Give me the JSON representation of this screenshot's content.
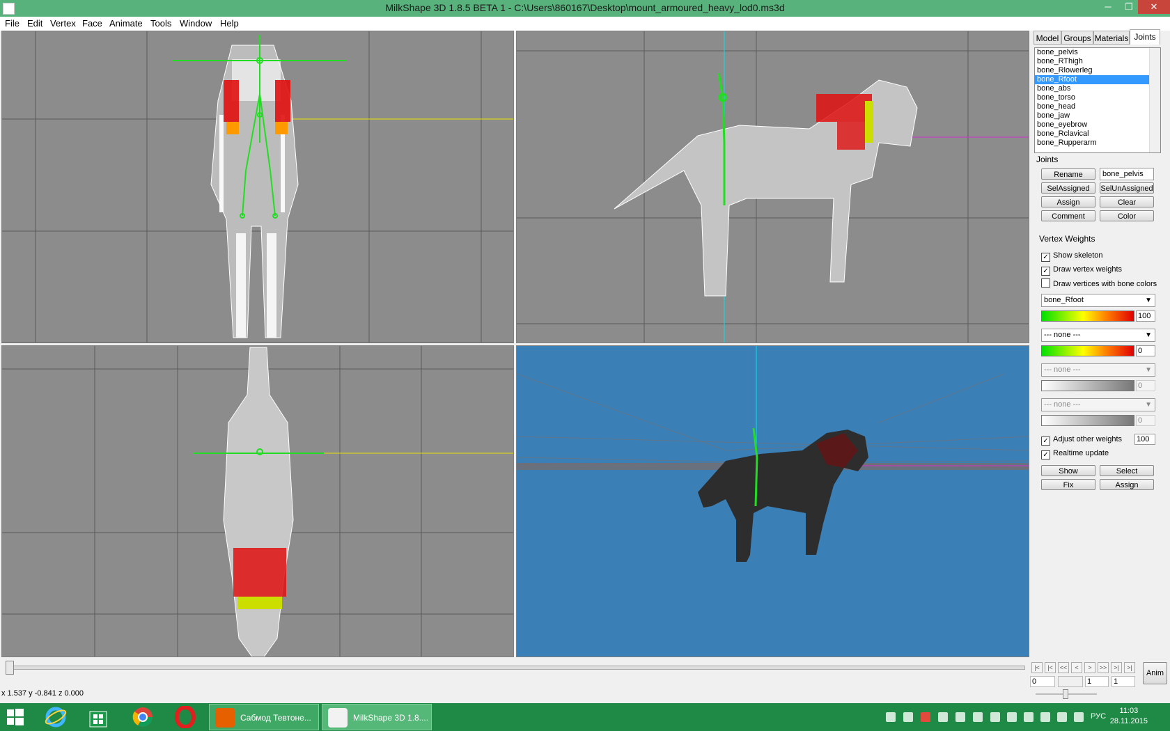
{
  "window": {
    "title": "MilkShape 3D 1.8.5 BETA 1 - C:\\Users\\860167\\Desktop\\mount_armoured_heavy_lod0.ms3d",
    "minimize": "─",
    "maximize": "❐",
    "close": "✕"
  },
  "menu": [
    "File",
    "Edit",
    "Vertex",
    "Face",
    "Animate",
    "Tools",
    "Window",
    "Help"
  ],
  "tabs": [
    "Model",
    "Groups",
    "Materials",
    "Joints"
  ],
  "joints": {
    "list": [
      "bone_pelvis",
      "bone_RThigh",
      "bone_Rlowerleg",
      "bone_Rfoot",
      "bone_abs",
      "bone_torso",
      "bone_head",
      "bone_jaw",
      "bone_eyebrow",
      "bone_Rclavical",
      "bone_Rupperarm"
    ],
    "selected_index": 3,
    "group_label": "Joints",
    "name_field": "bone_pelvis",
    "buttons": {
      "rename": "Rename",
      "sel_assigned": "SelAssigned",
      "sel_unassigned": "SelUnAssigned",
      "assign": "Assign",
      "clear": "Clear",
      "comment": "Comment",
      "color": "Color"
    }
  },
  "vertex_weights": {
    "group_label": "Vertex Weights",
    "show_skeleton": {
      "label": "Show skeleton",
      "checked": true
    },
    "draw_vertex_weights": {
      "label": "Draw vertex weights",
      "checked": true
    },
    "draw_bone_colors": {
      "label": "Draw vertices with bone colors",
      "checked": false
    },
    "bone1": {
      "value": "bone_Rfoot",
      "weight": "100"
    },
    "bone2": {
      "value": "--- none ---",
      "weight": "0"
    },
    "bone3": {
      "value": "--- none ---",
      "weight": "0"
    },
    "bone4": {
      "value": "--- none ---",
      "weight": "0"
    },
    "adjust_other": {
      "label": "Adjust other weights",
      "checked": true,
      "value": "100"
    },
    "realtime": {
      "label": "Realtime update",
      "checked": true
    },
    "buttons": {
      "show": "Show",
      "select": "Select",
      "fix": "Fix",
      "assign": "Assign"
    }
  },
  "timeline": {
    "frame_start": "0",
    "frame_current": "1",
    "frame_end": "1",
    "anim_label": "Anim",
    "nav": [
      "|<",
      "|<",
      "<<",
      "<",
      ">",
      ">>",
      ">|",
      ">|"
    ]
  },
  "status": "x 1.537 y -0.841 z 0.000",
  "taskbar": {
    "tasks": [
      "Сабмод Тевтоне...",
      "MilkShape 3D 1.8...."
    ],
    "lang": "РУС",
    "time": "11:03",
    "date": "28.11.2015"
  },
  "colors": {
    "titlebar": "#57b27b",
    "taskbar": "#1f8a46",
    "viewport_bg": "#8c8c8c",
    "viewport_3d_bg": "#3a7fb5",
    "bone": "#22dd22",
    "selection": "#3399ff"
  }
}
